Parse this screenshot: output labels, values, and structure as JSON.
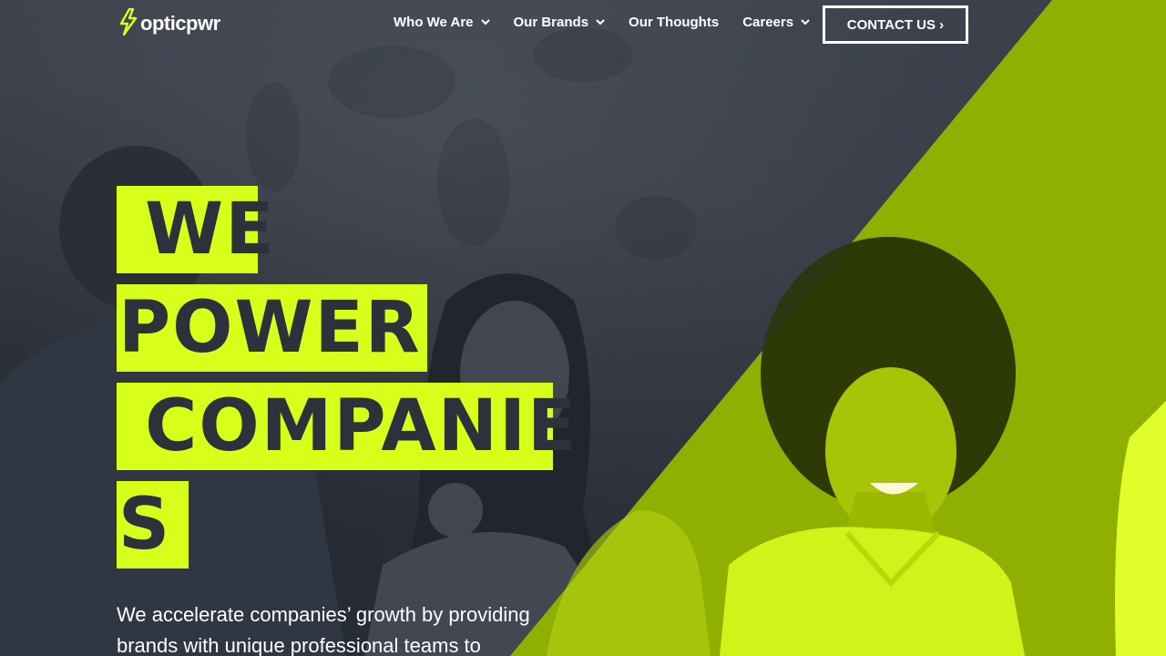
{
  "brand": {
    "name": "opticpwr",
    "accent_color": "#d7ff1a",
    "dark_color": "#2c313b",
    "logo_icon": "lightning-bolt-icon"
  },
  "nav": {
    "items": [
      {
        "label": "Who We Are",
        "has_dropdown": true
      },
      {
        "label": "Our Brands",
        "has_dropdown": true
      },
      {
        "label": "Our Thoughts",
        "has_dropdown": false
      },
      {
        "label": "Careers",
        "has_dropdown": true
      }
    ],
    "contact_label": "CONTACT US ›"
  },
  "hero": {
    "headline_lines": [
      " WE",
      "POWER ",
      " COMPANIE",
      "S "
    ],
    "subtitle": "We accelerate companies’ growth by providing brands with unique professional teams to"
  }
}
